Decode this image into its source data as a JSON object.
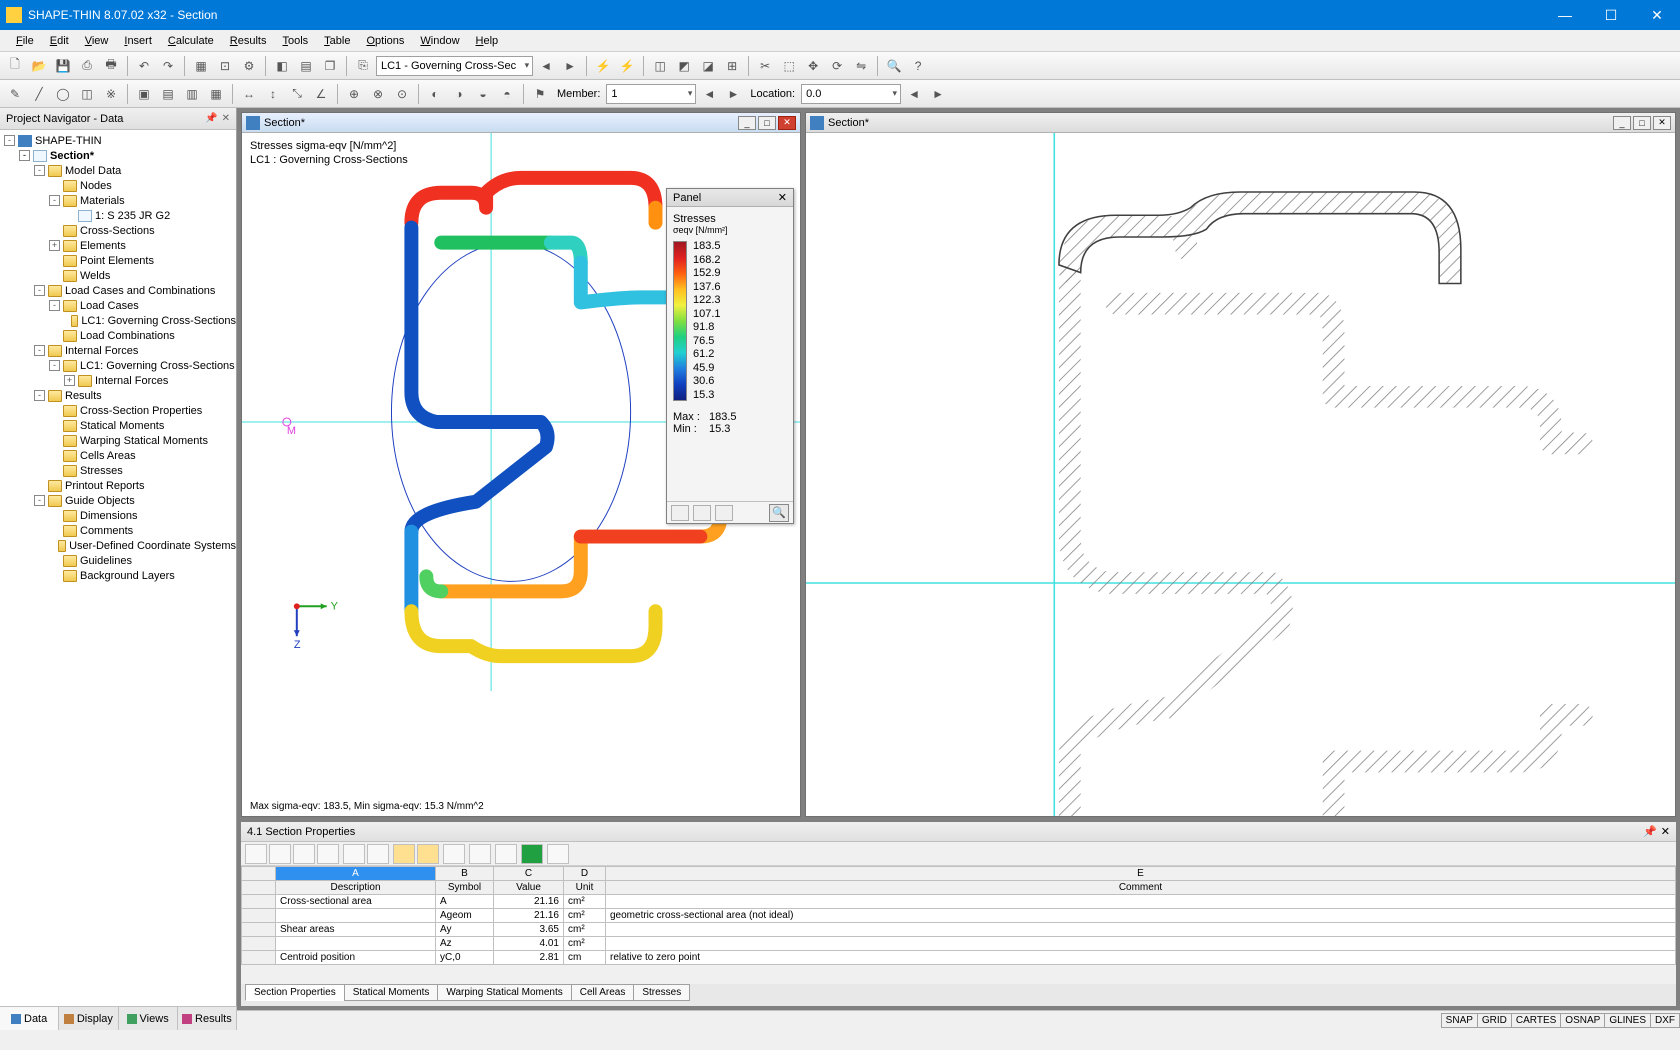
{
  "app": {
    "title": "SHAPE-THIN 8.07.02 x32 - Section"
  },
  "menu": [
    "File",
    "Edit",
    "View",
    "Insert",
    "Calculate",
    "Results",
    "Tools",
    "Table",
    "Options",
    "Window",
    "Help"
  ],
  "toolbar": {
    "load_case_combo": "LC1 - Governing Cross-Sec",
    "member_label": "Member:",
    "member_value": "1",
    "location_label": "Location:",
    "location_value": "0.0"
  },
  "navigator": {
    "title": "Project Navigator - Data",
    "root": "SHAPE-THIN",
    "section": "Section*",
    "nodes": [
      {
        "d": 1,
        "exp": "-",
        "icon": "root",
        "label": "SHAPE-THIN"
      },
      {
        "d": 2,
        "exp": "-",
        "icon": "page",
        "label": "Section*",
        "bold": true
      },
      {
        "d": 3,
        "exp": "-",
        "icon": "folder",
        "label": "Model Data"
      },
      {
        "d": 4,
        "exp": "",
        "icon": "folder",
        "label": "Nodes"
      },
      {
        "d": 4,
        "exp": "-",
        "icon": "folder",
        "label": "Materials"
      },
      {
        "d": 5,
        "exp": "",
        "icon": "page",
        "label": "1: S 235 JR G2"
      },
      {
        "d": 4,
        "exp": "",
        "icon": "folder",
        "label": "Cross-Sections"
      },
      {
        "d": 4,
        "exp": "+",
        "icon": "folder",
        "label": "Elements"
      },
      {
        "d": 4,
        "exp": "",
        "icon": "folder",
        "label": "Point Elements"
      },
      {
        "d": 4,
        "exp": "",
        "icon": "folder",
        "label": "Welds"
      },
      {
        "d": 3,
        "exp": "-",
        "icon": "folder",
        "label": "Load Cases and Combinations"
      },
      {
        "d": 4,
        "exp": "-",
        "icon": "folder",
        "label": "Load Cases"
      },
      {
        "d": 5,
        "exp": "",
        "icon": "folder",
        "label": "LC1: Governing Cross-Sections"
      },
      {
        "d": 4,
        "exp": "",
        "icon": "folder",
        "label": "Load Combinations"
      },
      {
        "d": 3,
        "exp": "-",
        "icon": "folder",
        "label": "Internal Forces"
      },
      {
        "d": 4,
        "exp": "-",
        "icon": "folder",
        "label": "LC1: Governing Cross-Sections"
      },
      {
        "d": 5,
        "exp": "+",
        "icon": "folder",
        "label": "Internal Forces"
      },
      {
        "d": 3,
        "exp": "-",
        "icon": "folder",
        "label": "Results"
      },
      {
        "d": 4,
        "exp": "",
        "icon": "folder",
        "label": "Cross-Section Properties"
      },
      {
        "d": 4,
        "exp": "",
        "icon": "folder",
        "label": "Statical Moments"
      },
      {
        "d": 4,
        "exp": "",
        "icon": "folder",
        "label": "Warping Statical Moments"
      },
      {
        "d": 4,
        "exp": "",
        "icon": "folder",
        "label": "Cells Areas"
      },
      {
        "d": 4,
        "exp": "",
        "icon": "folder",
        "label": "Stresses"
      },
      {
        "d": 3,
        "exp": "",
        "icon": "folder",
        "label": "Printout Reports"
      },
      {
        "d": 3,
        "exp": "-",
        "icon": "folder",
        "label": "Guide Objects"
      },
      {
        "d": 4,
        "exp": "",
        "icon": "folder",
        "label": "Dimensions"
      },
      {
        "d": 4,
        "exp": "",
        "icon": "folder",
        "label": "Comments"
      },
      {
        "d": 4,
        "exp": "",
        "icon": "folder",
        "label": "User-Defined Coordinate Systems"
      },
      {
        "d": 4,
        "exp": "",
        "icon": "folder",
        "label": "Guidelines"
      },
      {
        "d": 4,
        "exp": "",
        "icon": "folder",
        "label": "Background Layers"
      }
    ],
    "tabs": [
      "Data",
      "Display",
      "Views",
      "Results"
    ]
  },
  "docs": {
    "left_title": "Section*",
    "right_title": "Section*",
    "stress_header_line1": "Stresses sigma-eqv [N/mm^2]",
    "stress_header_line2": "LC1 : Governing Cross-Sections",
    "stress_footer": "Max sigma-eqv: 183.5, Min sigma-eqv: 15.3 N/mm^2"
  },
  "panel": {
    "title": "Panel",
    "heading": "Stresses",
    "unit_label": "σeqv [N/mm²]",
    "ticks": [
      "183.5",
      "168.2",
      "152.9",
      "137.6",
      "122.3",
      "107.1",
      "91.8",
      "76.5",
      "61.2",
      "45.9",
      "30.6",
      "15.3"
    ],
    "max_label": "Max  :",
    "max_value": "183.5",
    "min_label": "Min   :",
    "min_value": "15.3"
  },
  "chart_data": {
    "type": "colorbar-legend",
    "title": "Stresses σeqv [N/mm²]",
    "values": [
      183.5,
      168.2,
      152.9,
      137.6,
      122.3,
      107.1,
      91.8,
      76.5,
      61.2,
      45.9,
      30.6,
      15.3
    ],
    "colors_top_to_bottom": [
      "#a01820",
      "#e02020",
      "#ff6010",
      "#ffc020",
      "#f0f040",
      "#80e040",
      "#20d080",
      "#20d0d0",
      "#2080e0",
      "#1040c0",
      "#102080"
    ],
    "max": 183.5,
    "min": 15.3,
    "unit": "N/mm²"
  },
  "table": {
    "title": "4.1 Section Properties",
    "col_letters": [
      "A",
      "B",
      "C",
      "D",
      "E"
    ],
    "headers": [
      "Description",
      "Symbol",
      "Value",
      "Unit",
      "Comment"
    ],
    "rows": [
      {
        "desc": "Cross-sectional area",
        "sym": "A",
        "val": "21.16",
        "unit": "cm²",
        "comment": ""
      },
      {
        "desc": "",
        "sym": "Ageom",
        "val": "21.16",
        "unit": "cm²",
        "comment": "geometric cross-sectional area (not ideal)"
      },
      {
        "desc": "Shear areas",
        "sym": "Ay",
        "val": "3.65",
        "unit": "cm²",
        "comment": ""
      },
      {
        "desc": "",
        "sym": "Az",
        "val": "4.01",
        "unit": "cm²",
        "comment": ""
      },
      {
        "desc": "Centroid position",
        "sym": "yC,0",
        "val": "2.81",
        "unit": "cm",
        "comment": "relative to zero point"
      }
    ],
    "tabs": [
      "Section Properties",
      "Statical Moments",
      "Warping Statical Moments",
      "Cell Areas",
      "Stresses"
    ]
  },
  "status": [
    "SNAP",
    "GRID",
    "CARTES",
    "OSNAP",
    "GLINES",
    "DXF"
  ]
}
